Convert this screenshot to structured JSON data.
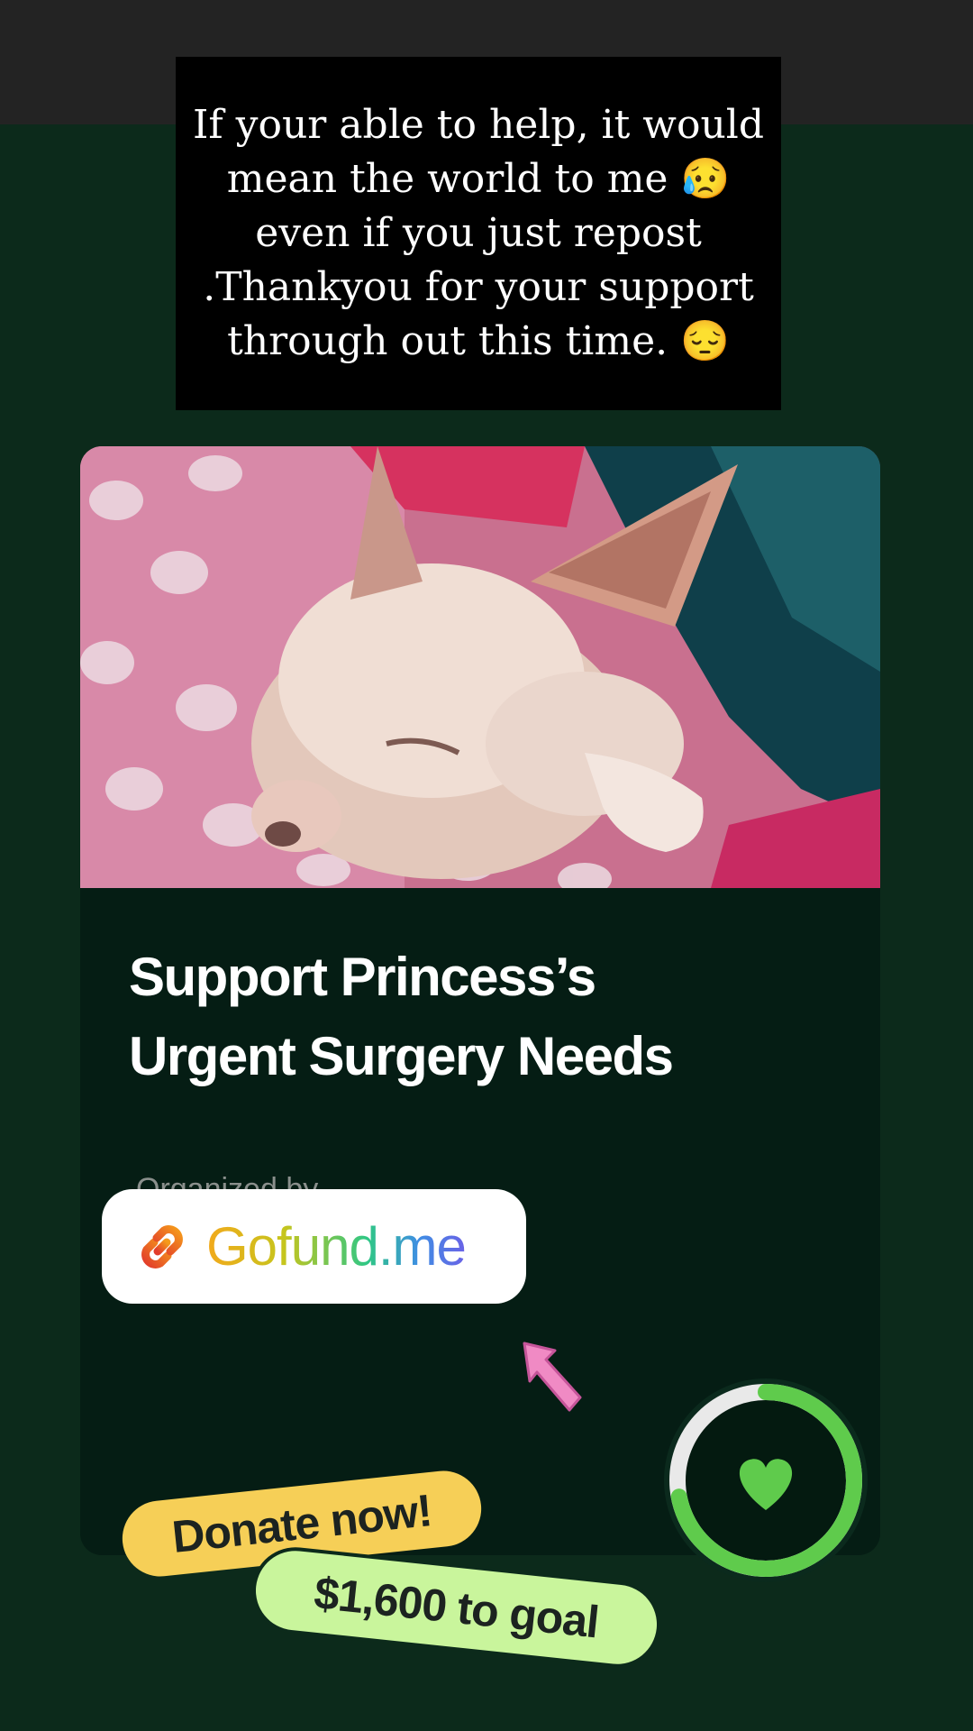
{
  "caption": {
    "text": "If your able to help, it would mean the world to me 😥 even if you just repost  .Thankyou for your support through out this time. 😔"
  },
  "campaign": {
    "title_line1": "Support Princess’s",
    "title_line2": "Urgent Surgery Needs",
    "organizer_partial": "Organized by",
    "photo_alt": "sleeping-chihuahua-photo",
    "progress_fraction": 0.72
  },
  "link_sticker": {
    "text": "Gofund.me",
    "icon": "link-icon"
  },
  "stickers": {
    "donate": "Donate now!",
    "goal": "$1,600 to goal"
  },
  "colors": {
    "background": "#0c2a1b",
    "card": "#051d14",
    "donate_sticker": "#f6cf57",
    "goal_sticker": "#c9f59c",
    "progress_green": "#5fcb4c",
    "arrow_pink": "#f08ac4"
  }
}
